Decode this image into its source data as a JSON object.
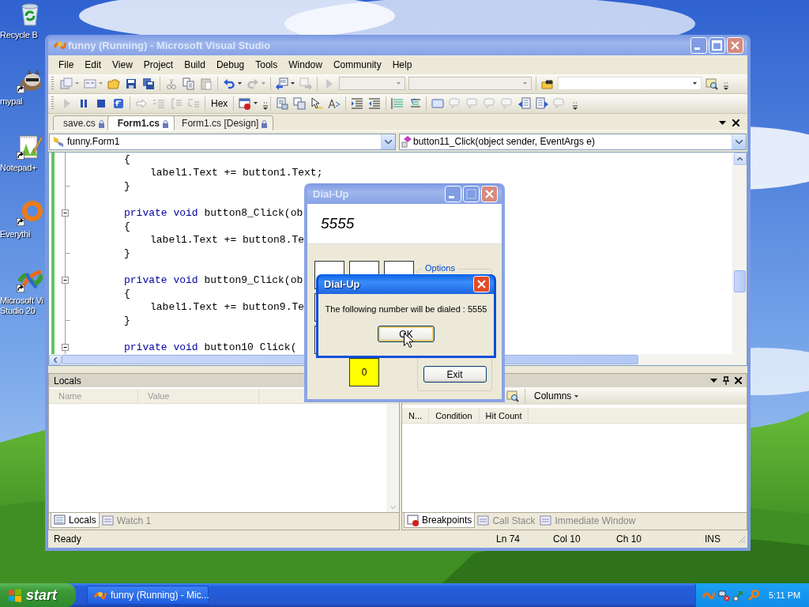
{
  "desktop": {
    "icons": [
      {
        "kind": "recycle-bin",
        "shortcut": false,
        "lines": [
          "Recycle B"
        ]
      },
      {
        "kind": "raccoon",
        "shortcut": true,
        "lines": [
          "mypal"
        ]
      },
      {
        "kind": "notepad",
        "shortcut": true,
        "lines": [
          "Notepad+"
        ]
      },
      {
        "kind": "ring",
        "shortcut": true,
        "lines": [
          "Everythi"
        ]
      },
      {
        "kind": "visual-studio",
        "shortcut": true,
        "lines": [
          "Microsoft Vi",
          "Studio 20"
        ]
      }
    ]
  },
  "ide": {
    "title": "funny (Running) - Microsoft Visual Studio",
    "active": false,
    "menu": [
      "File",
      "Edit",
      "View",
      "Project",
      "Build",
      "Debug",
      "Tools",
      "Window",
      "Community",
      "Help"
    ],
    "debug_toolbar": {
      "hex_button": "Hex"
    },
    "doc_tabs": [
      {
        "label": "save.cs",
        "selected": false
      },
      {
        "label": "Form1.cs",
        "selected": true
      },
      {
        "label": "Form1.cs [Design]",
        "selected": false
      }
    ],
    "type_combo": "funny.Form1",
    "member_combo": "button11_Click(object sender, EventArgs e)",
    "code_lines": [
      {
        "kind": "brace",
        "text": "{"
      },
      {
        "kind": "statement",
        "text": "label1.Text += button1.Text;"
      },
      {
        "kind": "end",
        "text": "}"
      },
      {
        "kind": "blank"
      },
      {
        "kind": "method",
        "keyword": "private void",
        "text": "button8_Click(ob"
      },
      {
        "kind": "brace",
        "text": "{"
      },
      {
        "kind": "statement",
        "text": "label1.Text += button8.Te"
      },
      {
        "kind": "end",
        "text": "}"
      },
      {
        "kind": "blank"
      },
      {
        "kind": "method",
        "keyword": "private void",
        "text": "button9_Click(ob"
      },
      {
        "kind": "brace",
        "text": "{"
      },
      {
        "kind": "statement",
        "text": "label1.Text += button9.Te"
      },
      {
        "kind": "end",
        "text": "}"
      },
      {
        "kind": "blank"
      },
      {
        "kind": "method",
        "keyword": "private void",
        "text": "button10 Click("
      }
    ],
    "locals_panel": {
      "title": "Locals",
      "columns": [
        "Name",
        "Value"
      ],
      "tabs": [
        {
          "label": "Locals",
          "selected": true
        },
        {
          "label": "Watch 1",
          "selected": false
        }
      ]
    },
    "breakpoints_panel": {
      "columns_button": "Columns",
      "columns": [
        "N...",
        "Condition",
        "Hit Count"
      ],
      "tabs": [
        {
          "label": "Breakpoints",
          "selected": true
        },
        {
          "label": "Call Stack",
          "selected": false
        },
        {
          "label": "Immediate Window",
          "selected": false
        }
      ]
    },
    "status_bar": {
      "message": "Ready",
      "line": "Ln 74",
      "column": "Col 10",
      "char": "Ch 10",
      "mode": "INS"
    }
  },
  "dialer": {
    "title": "Dial-Up",
    "active": false,
    "display": "5555",
    "zero_button": "0",
    "options_label": "Options",
    "exit_button": "Exit"
  },
  "message_box": {
    "title": "Dial-Up",
    "active": true,
    "text": "The following number will be dialed : 5555",
    "ok_button": "OK"
  },
  "taskbar": {
    "start_button": "start",
    "tasks": [
      {
        "label": "funny (Running) - Mic..."
      }
    ],
    "clock": "5:11 PM"
  }
}
